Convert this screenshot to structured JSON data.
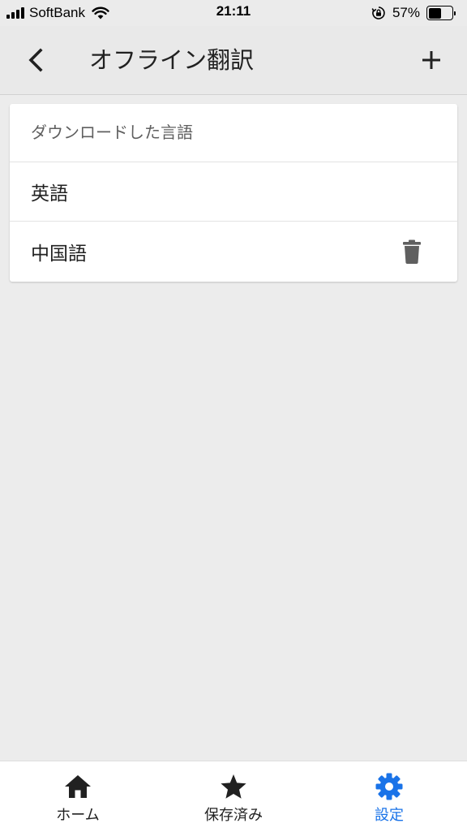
{
  "status_bar": {
    "carrier": "SoftBank",
    "time": "21:11",
    "battery_percent_text": "57%",
    "battery_level": 0.57
  },
  "header": {
    "title": "オフライン翻訳",
    "back_icon": "chevron-left-icon",
    "add_icon": "plus-icon"
  },
  "downloaded": {
    "section_title": "ダウンロードした言語",
    "languages": [
      {
        "name": "英語",
        "deletable": false
      },
      {
        "name": "中国語",
        "deletable": true
      }
    ]
  },
  "bottom_nav": {
    "items": [
      {
        "label": "ホーム",
        "icon": "home-icon",
        "active": false
      },
      {
        "label": "保存済み",
        "icon": "star-icon",
        "active": false
      },
      {
        "label": "設定",
        "icon": "gear-icon",
        "active": true
      }
    ]
  },
  "colors": {
    "accent": "#1a73e8",
    "background": "#ececec",
    "header_background": "#e9e9e9",
    "card": "#ffffff",
    "icon_dark": "#212121",
    "trash_icon": "#5f5f5f"
  }
}
